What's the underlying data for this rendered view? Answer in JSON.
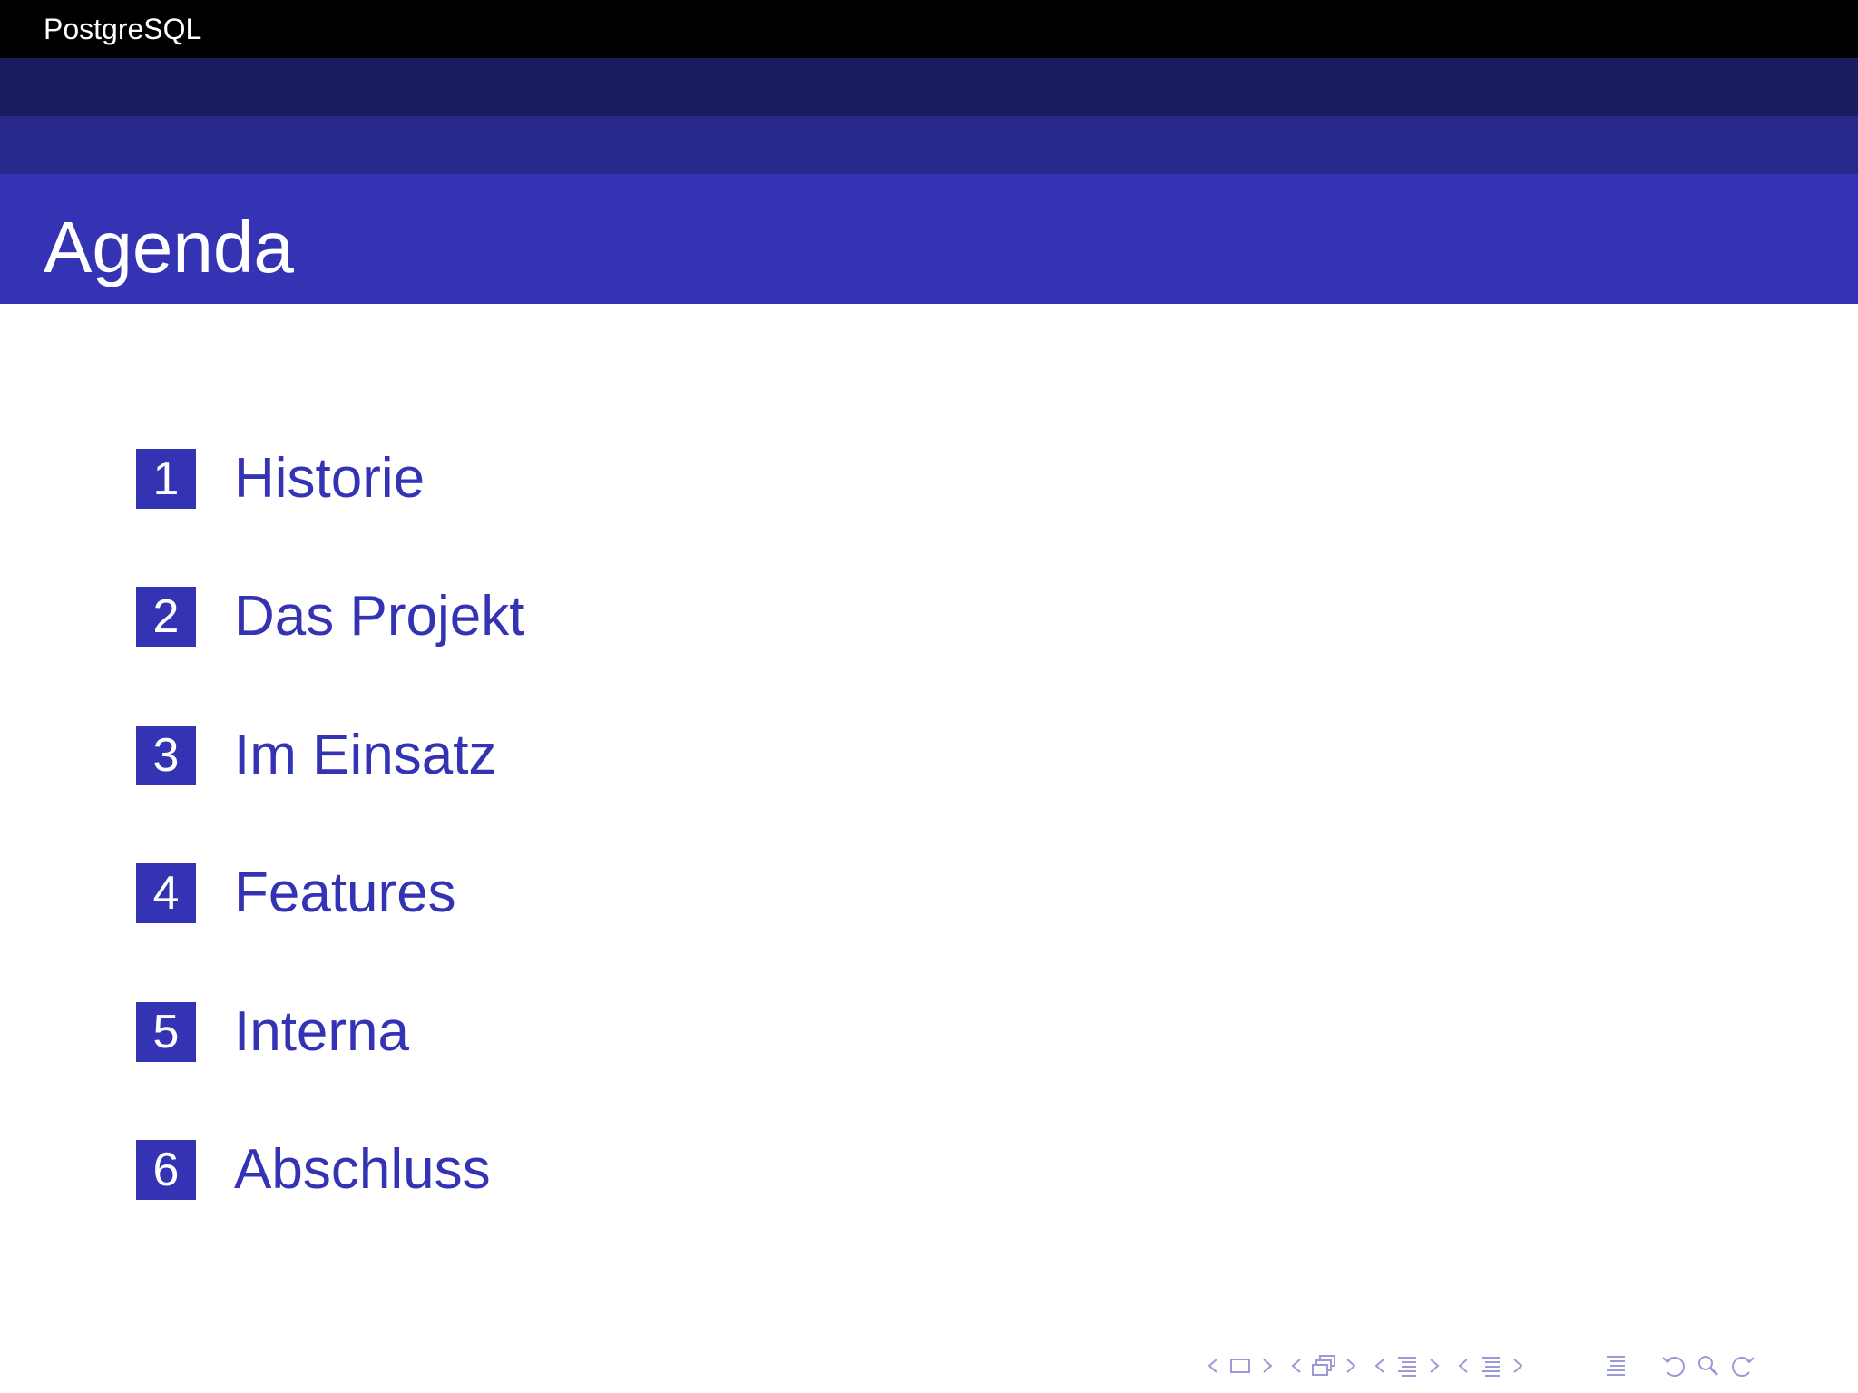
{
  "header": {
    "short_title": "PostgreSQL"
  },
  "frame": {
    "title": "Agenda"
  },
  "toc": {
    "items": [
      {
        "number": "1",
        "label": "Historie"
      },
      {
        "number": "2",
        "label": "Das Projekt"
      },
      {
        "number": "3",
        "label": "Im Einsatz"
      },
      {
        "number": "4",
        "label": "Features"
      },
      {
        "number": "5",
        "label": "Interna"
      },
      {
        "number": "6",
        "label": "Abschluss"
      }
    ]
  },
  "navigation": {
    "icons": [
      "prev-frame-icon",
      "frame-icon",
      "next-frame-icon",
      "prev-subsection-icon",
      "subsection-icon",
      "next-subsection-icon",
      "prev-section-icon",
      "section-icon",
      "next-section-icon",
      "prev-slide-icon",
      "slide-icon",
      "next-slide-icon",
      "toc-icon",
      "back-icon",
      "search-icon",
      "forward-icon"
    ]
  },
  "colors": {
    "headline": "#000000",
    "band_dark": "#1a1c5e",
    "band_mid": "#272889",
    "title_bar": "#3333b3",
    "accent": "#3333b3",
    "nav": "#9a9ad6"
  }
}
